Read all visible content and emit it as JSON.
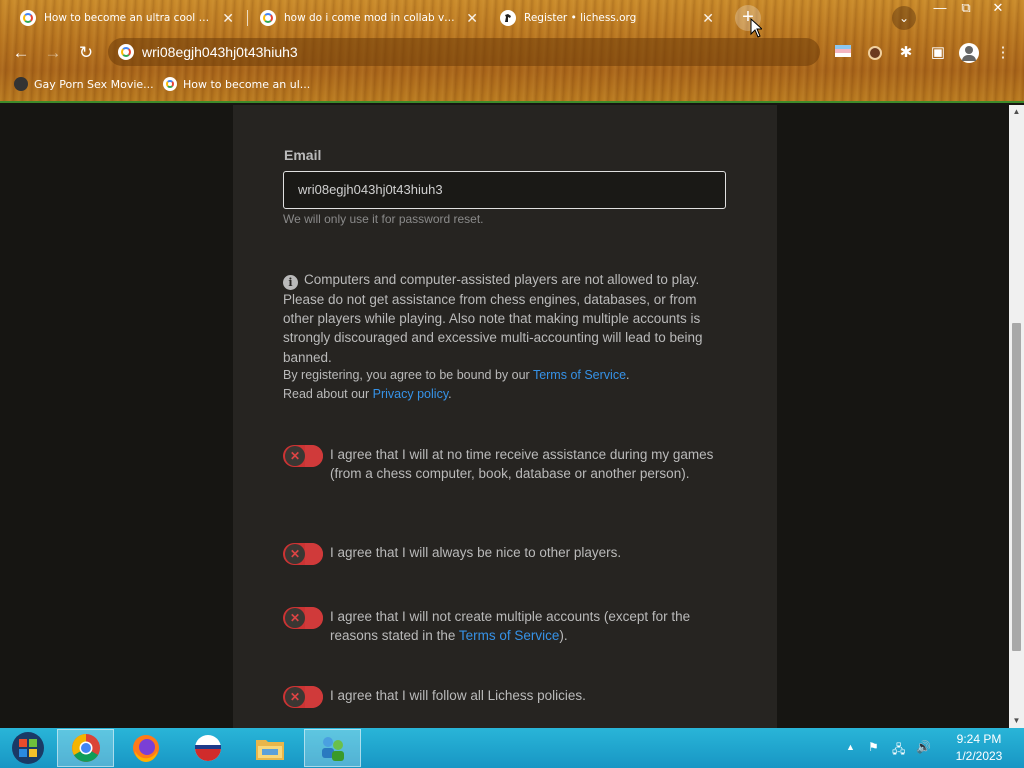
{
  "browser": {
    "tabs": [
      {
        "title": "How to become an ultra cool mod",
        "close": "✕"
      },
      {
        "title": "how do i come mod in collab vm so",
        "close": "✕"
      },
      {
        "title": "Register • lichess.org",
        "close": "✕"
      }
    ],
    "new_tab": "+",
    "url": "wri08egjh043hj0t43hiuh3",
    "bookmarks": [
      {
        "label": "Gay Porn Sex Movie..."
      },
      {
        "label": "How to become an ul..."
      }
    ]
  },
  "form": {
    "email_label": "Email",
    "email_value": "wri08egjh043hj0t43hiuh3",
    "email_help": "We will only use it for password reset.",
    "warning_text": "Computers and computer-assisted players are not allowed to play. Please do not get assistance from chess engines, databases, or from other players while playing. Also note that making multiple accounts is strongly discouraged and excessive multi-accounting will lead to being banned.",
    "terms_prefix": "By registering, you agree to be bound by our ",
    "terms_link": "Terms of Service",
    "terms_suffix": ".",
    "privacy_prefix": "Read about our ",
    "privacy_link": "Privacy policy",
    "privacy_suffix": ".",
    "agreements": [
      {
        "text": "I agree that I will at no time receive assistance during my games (from a chess computer, book, database or another person)."
      },
      {
        "text": "I agree that I will always be nice to other players."
      },
      {
        "text_prefix": "I agree that I will not create multiple accounts (except for the reasons stated in the ",
        "link": "Terms of Service",
        "text_suffix": ")."
      },
      {
        "text": "I agree that I will follow all Lichess policies."
      }
    ],
    "toggle_state": "off"
  },
  "taskbar": {
    "time": "9:24 PM",
    "date": "1/2/2023",
    "apps": [
      "start-orb",
      "chrome",
      "firefox",
      "opera",
      "file-explorer",
      "network-app"
    ]
  },
  "colors": {
    "chrome_bg": "#b7741f",
    "page_bg": "#161512",
    "panel_bg": "#262421",
    "link": "#3692e7",
    "toggle_off": "#cc3333",
    "taskbar": "#1ea6cf"
  }
}
